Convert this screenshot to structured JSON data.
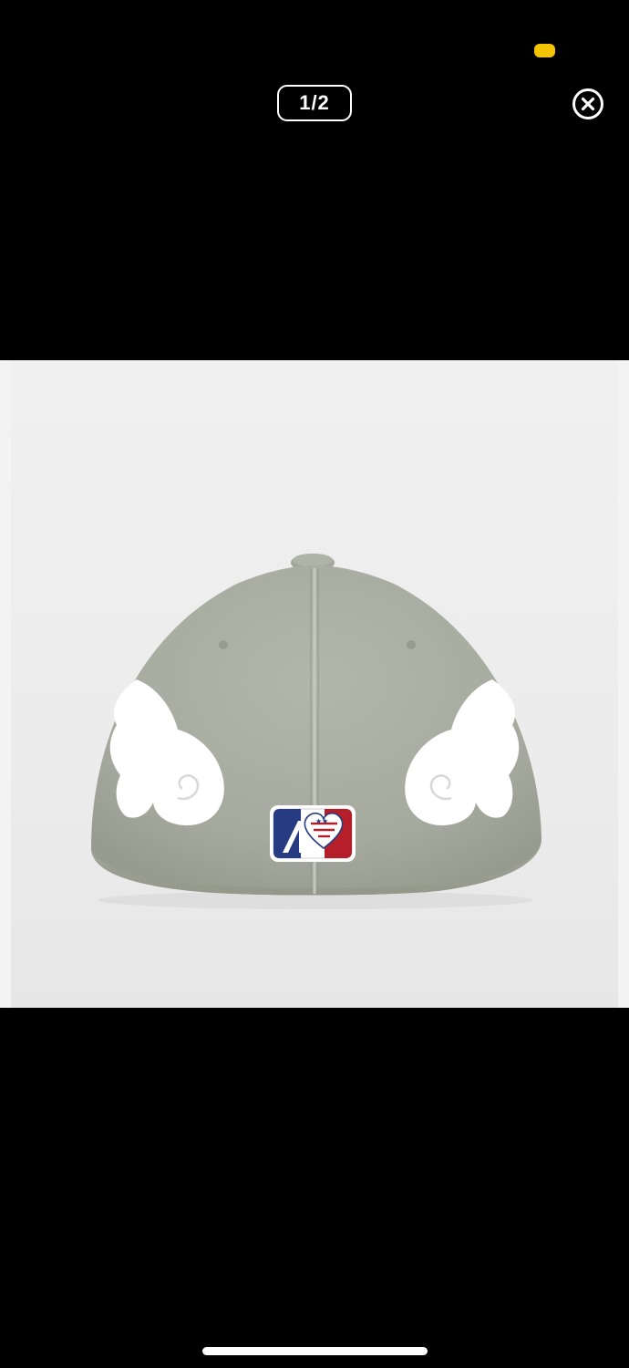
{
  "viewer": {
    "counter": "1/2",
    "close_icon": "close-circle-icon"
  },
  "status_bar": {
    "indicator_color": "#f5c400"
  },
  "image": {
    "logo_icon": "heart-flag-logo"
  },
  "colors": {
    "background": "#000000",
    "cap": "#a9ada1",
    "wings": "#ffffff",
    "flag_red": "#b41f2a",
    "flag_blue": "#263b82"
  }
}
